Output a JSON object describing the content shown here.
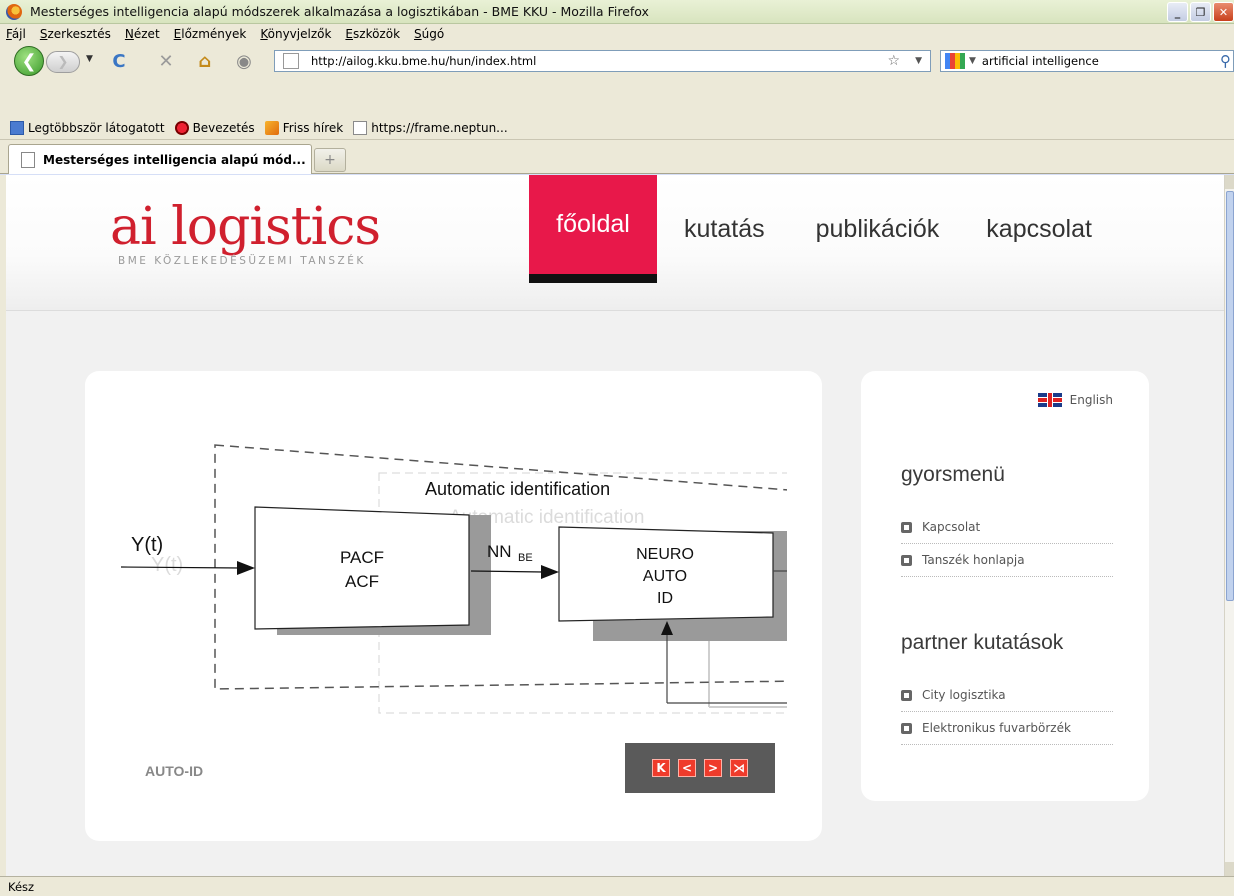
{
  "window": {
    "title": "Mesterséges intelligencia alapú módszerek alkalmazása a logisztikában - BME KKU - Mozilla Firefox",
    "buttons": [
      "_",
      "❐",
      "✕"
    ]
  },
  "menu": [
    "Fájl",
    "Szerkesztés",
    "Nézet",
    "Előzmények",
    "Könyvjelzők",
    "Eszközök",
    "Súgó"
  ],
  "nav": {
    "url": "http://ailog.kku.bme.hu/hun/index.html",
    "search_value": "artificial intelligence",
    "icons": [
      "back-icon",
      "forward-icon",
      "reload-icon",
      "stop-icon",
      "home-icon",
      "globe-icon",
      "star-icon",
      "search-icon"
    ]
  },
  "bookmarks": [
    "Legtöbbször látogatott",
    "Bevezetés",
    "Friss hírek",
    "https://frame.neptun..."
  ],
  "tabs": [
    {
      "label": "Mesterséges intelligencia alapú mód..."
    }
  ],
  "site": {
    "logo": "ai logistics",
    "logo_sub": "BME KÖZLEKEDÉSÜZEMI TANSZÉK",
    "nav": [
      "főoldal",
      "kutatás",
      "publikációk",
      "kapcsolat"
    ],
    "accent_color": "#e8184a",
    "logo_color": "#d0202e"
  },
  "slider": {
    "diagram": {
      "title": "Automatic identification",
      "input_label": "Y(t)",
      "block1": [
        "PACF",
        "ACF"
      ],
      "link_label": "NN",
      "link_sub": "BE",
      "block2": [
        "NEURO",
        "AUTO",
        "ID"
      ]
    },
    "caption": "AUTO-ID",
    "controls": [
      "K",
      "<",
      ">",
      "⋊"
    ]
  },
  "side": {
    "language": "English",
    "quick_menu_title": "gyorsmenü",
    "quick_menu": [
      "Kapcsolat",
      "Tanszék honlapja"
    ],
    "partner_title": "partner kutatások",
    "partner": [
      "City logisztika",
      "Elektronikus fuvarbörzék"
    ]
  },
  "status": "Kész"
}
